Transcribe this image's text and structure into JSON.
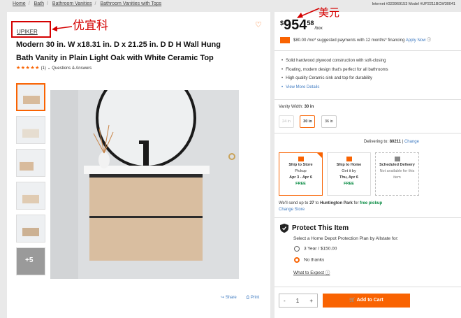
{
  "breadcrumb": [
    "Home",
    "Bath",
    "Bathroom Vanities",
    "Bathroom Vanities with Tops"
  ],
  "ids": "Internet #323969153  Model #UP2211BCW30041",
  "brand": "UPIKER",
  "annotation_brand": "优宜科",
  "annotation_price": "美元",
  "title": "Modern 30 in. W x18.31 in. D x 21.25 in. D D H Wall Hung Bath Vanity in Plain Light Oak with White Ceramic Top",
  "rating": {
    "stars": "★★★★★",
    "count": "(1)",
    "qa": "Questions & Answers"
  },
  "more_images": "+5",
  "share": "Share",
  "print": "Print",
  "price": {
    "currency": "$",
    "dollars": "954",
    "cents": "58",
    "unit": "/box"
  },
  "financing": {
    "text": "$80.00 /mo* suggested payments with 12 months* financing",
    "link": "Apply Now"
  },
  "bullets": [
    "Solid hardwood plywood construction with soft-closing",
    "Floating, modern design that's perfect for all bathrooms",
    "High quality Ceramic sink and top for durability"
  ],
  "view_more": "View More Details",
  "variant": {
    "label": "Vanity Width:",
    "value": "30 in",
    "options": [
      "24 in",
      "30 in",
      "36 in"
    ]
  },
  "delivery": {
    "label": "Delivering to:",
    "zip": "80211",
    "change": "Change"
  },
  "fulfillment": [
    {
      "title": "Ship to Store",
      "l1": "Pickup",
      "l2": "Apr 3 - Apr 6",
      "l3": "FREE"
    },
    {
      "title": "Ship to Home",
      "l1": "Get it by",
      "l2": "Thu, Apr 6",
      "l3": "FREE"
    },
    {
      "title": "Scheduled Delivery",
      "l1": "Not available for this",
      "l2": "item",
      "l3": ""
    }
  ],
  "send": {
    "pre": "We'll send up to",
    "qty": "27",
    "mid": "to",
    "store": "Huntington Park",
    "post": "for",
    "free": "free pickup",
    "change": "Change Store"
  },
  "protect": {
    "title": "Protect This Item",
    "sub": "Select a Home Depot Protection Plan by Allstate for:",
    "opt1": "3 Year / $150.00",
    "opt2": "No thanks",
    "link": "What to Expect"
  },
  "qty": {
    "minus": "-",
    "value": "1",
    "plus": "+"
  },
  "add_to_cart": "Add to Cart"
}
